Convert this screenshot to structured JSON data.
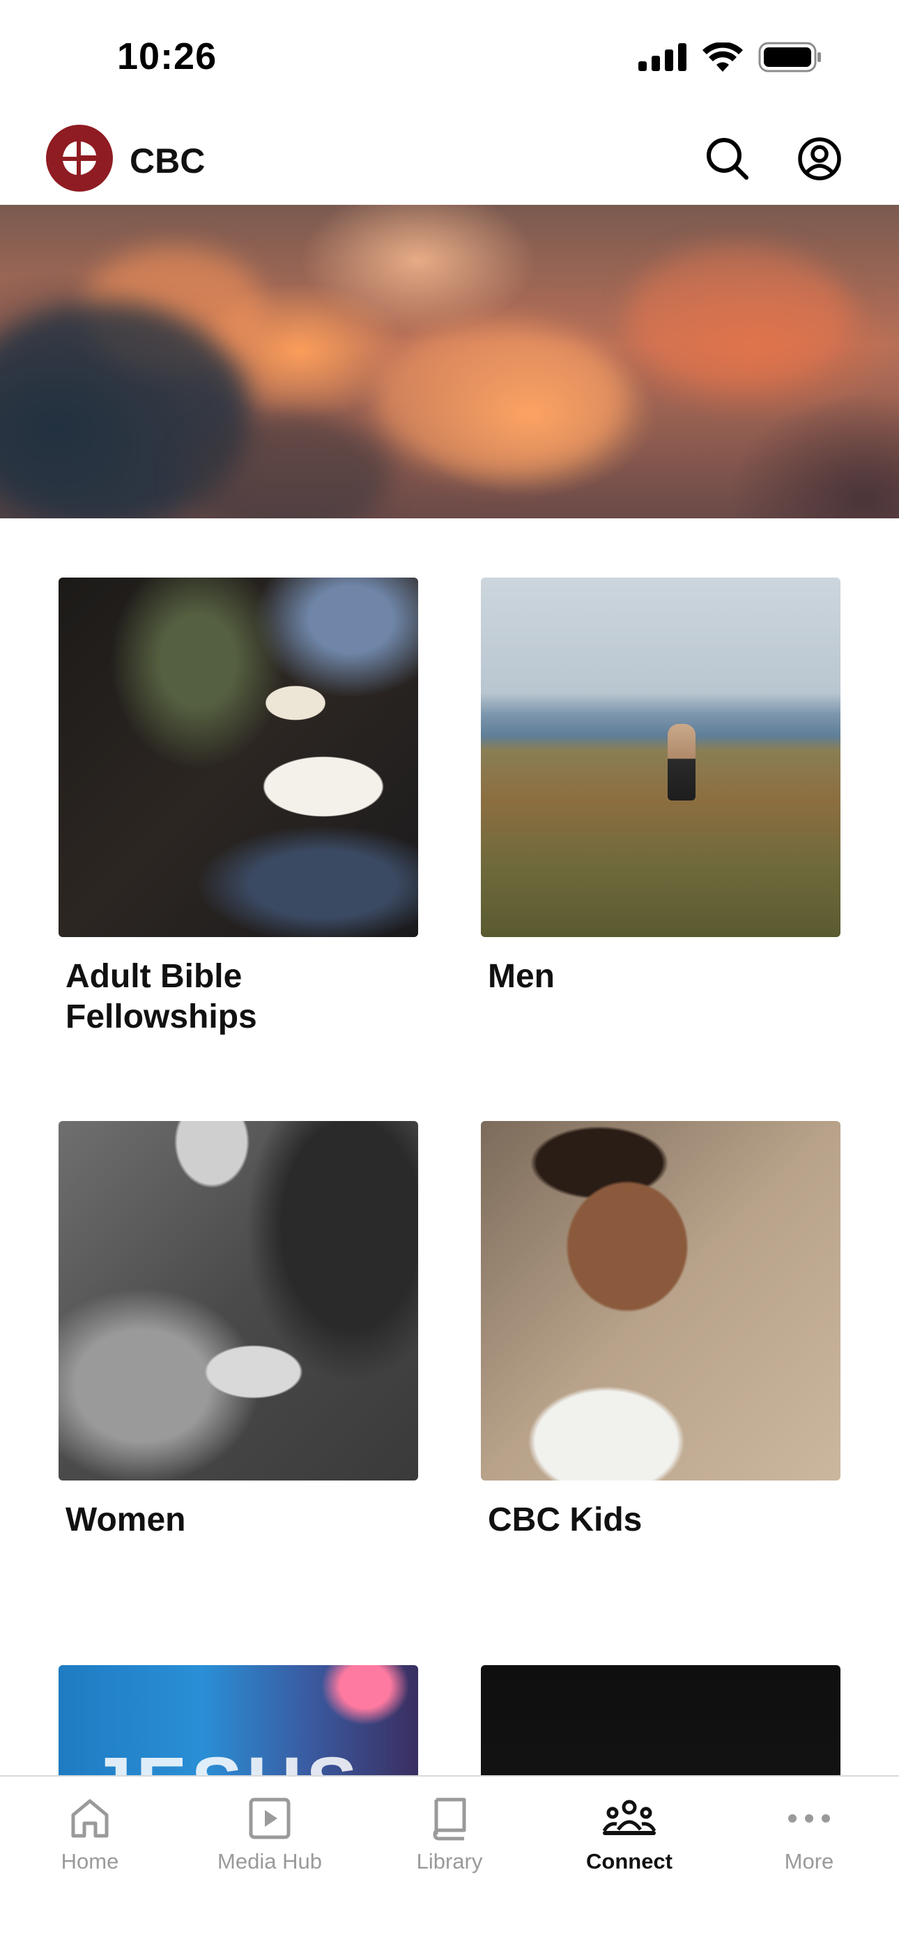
{
  "status_bar": {
    "time": "10:26"
  },
  "header": {
    "brand_name": "CBC",
    "logo_icon": "cbc-logo-icon",
    "search_icon": "search-icon",
    "account_icon": "account-icon"
  },
  "colors": {
    "brand": "#8f1c22",
    "tab_active": "#111111",
    "tab_inactive": "#9a9a9a"
  },
  "groups": [
    {
      "title": "Adult Bible Fellowships"
    },
    {
      "title": "Men"
    },
    {
      "title": "Women"
    },
    {
      "title": "CBC Kids"
    },
    {
      "title": "",
      "image_text": "JESUS"
    },
    {
      "title": ""
    }
  ],
  "tabs": [
    {
      "label": "Home",
      "icon": "home-icon",
      "active": false
    },
    {
      "label": "Media Hub",
      "icon": "play-icon",
      "active": false
    },
    {
      "label": "Library",
      "icon": "book-icon",
      "active": false
    },
    {
      "label": "Connect",
      "icon": "people-icon",
      "active": true
    },
    {
      "label": "More",
      "icon": "more-icon",
      "active": false
    }
  ]
}
